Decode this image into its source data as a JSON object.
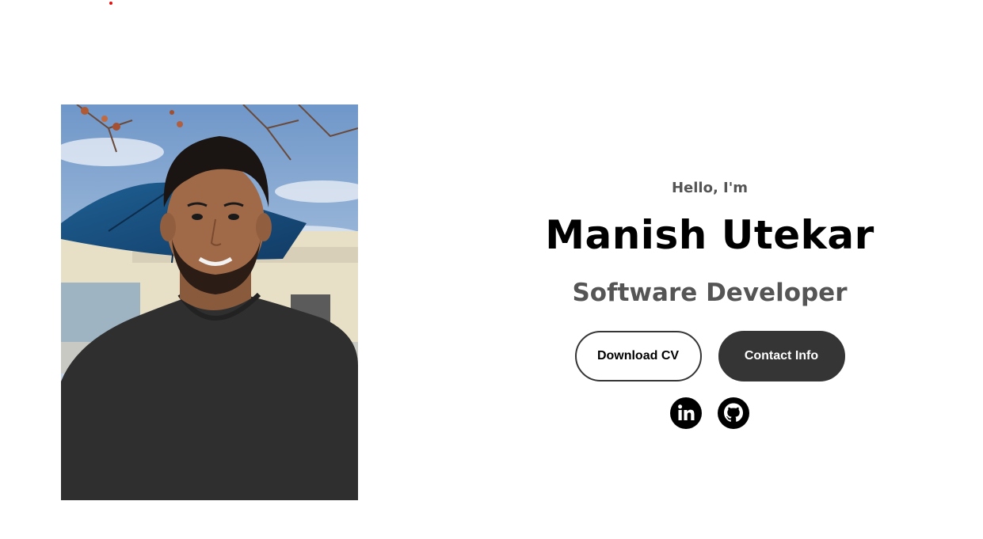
{
  "colors": {
    "accent_dot": "#e01010",
    "button_dark": "#353535",
    "subtext": "#555555",
    "title": "#000000"
  },
  "profile": {
    "image_alt": "Profile picture of Manish Utekar"
  },
  "intro": {
    "greeting": "Hello, I'm",
    "name": "Manish Utekar",
    "title": "Software Developer"
  },
  "buttons": {
    "download_cv": "Download CV",
    "contact_info": "Contact Info"
  },
  "socials": [
    {
      "icon": "linkedin-icon",
      "label": "LinkedIn"
    },
    {
      "icon": "github-icon",
      "label": "GitHub"
    }
  ]
}
